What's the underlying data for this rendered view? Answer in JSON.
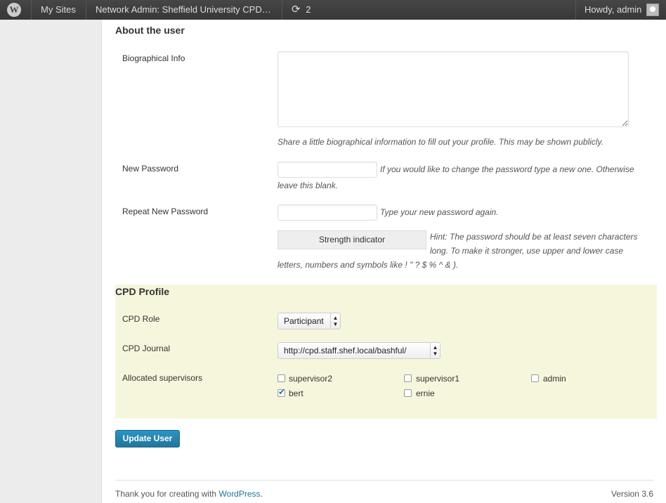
{
  "adminbar": {
    "logo": "W",
    "my_sites": "My Sites",
    "network_admin": "Network Admin: Sheffield University CPD…",
    "updates_icon": "refresh-icon",
    "updates_count": "2",
    "howdy": "Howdy, admin"
  },
  "about": {
    "heading": "About the user",
    "bio_label": "Biographical Info",
    "bio_value": "",
    "bio_desc": "Share a little biographical information to fill out your profile. This may be shown publicly.",
    "new_password_label": "New Password",
    "new_password_desc_1": "If you would like to change the password type a new one. Otherwise",
    "new_password_desc_2": "leave this blank.",
    "repeat_password_label": "Repeat New Password",
    "repeat_password_desc": "Type your new password again.",
    "strength_label": "Strength indicator",
    "hint_1": "Hint: The password should be at least seven characters",
    "hint_2": "long. To make it stronger, use upper and lower case",
    "hint_3": "letters, numbers and symbols like ! \" ? $ % ^ & )."
  },
  "cpd": {
    "heading": "CPD Profile",
    "role_label": "CPD Role",
    "role_value": "Participant",
    "journal_label": "CPD Journal",
    "journal_value": "http://cpd.staff.shef.local/bashful/",
    "supervisors_label": "Allocated supervisors",
    "supervisors": [
      {
        "name": "supervisor2",
        "checked": false
      },
      {
        "name": "supervisor1",
        "checked": false
      },
      {
        "name": "admin",
        "checked": false
      },
      {
        "name": "bert",
        "checked": true
      },
      {
        "name": "ernie",
        "checked": false
      }
    ]
  },
  "actions": {
    "update_label": "Update User"
  },
  "footer": {
    "thanks_prefix": "Thank you for creating with ",
    "wordpress_link": "WordPress",
    "thanks_suffix": ".",
    "version": "Version 3.6"
  },
  "colors": {
    "accent": "#21759b",
    "cpd_background": "#f6f6dd"
  }
}
